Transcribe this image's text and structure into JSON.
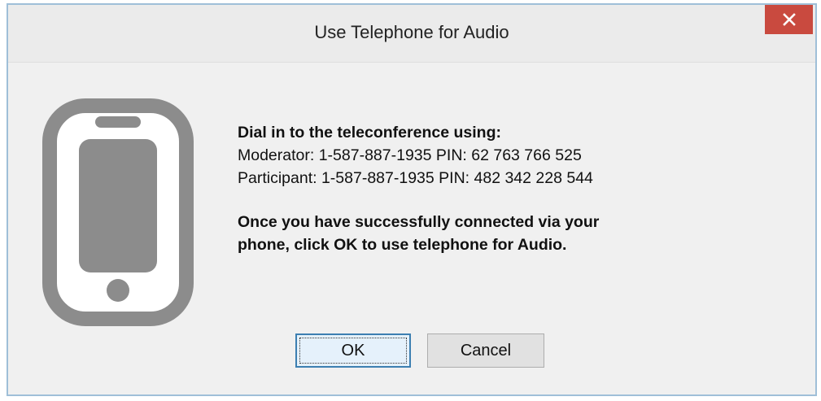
{
  "dialog": {
    "title": "Use Telephone for Audio",
    "close_icon": "close-icon",
    "phone_icon": "mobile-phone-icon",
    "accent_color": "#c94a3f",
    "message": {
      "heading": "Dial in to the teleconference using:",
      "moderator_line": "Moderator: 1-587-887-1935 PIN: 62 763 766 525",
      "participant_line": "Participant: 1-587-887-1935 PIN: 482 342 228 544",
      "instruction_line1": "Once you have successfully connected via your",
      "instruction_line2": "phone, click OK to use telephone for Audio."
    },
    "buttons": {
      "ok_label": "OK",
      "cancel_label": "Cancel"
    }
  }
}
